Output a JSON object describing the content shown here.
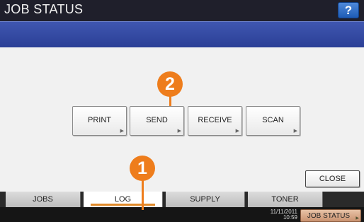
{
  "window": {
    "title": "JOB STATUS",
    "help_label": "?"
  },
  "log_buttons": [
    {
      "label": "PRINT"
    },
    {
      "label": "SEND"
    },
    {
      "label": "RECEIVE"
    },
    {
      "label": "SCAN"
    }
  ],
  "close_label": "CLOSE",
  "tabs": [
    {
      "label": "JOBS",
      "active": false
    },
    {
      "label": "LOG",
      "active": true
    },
    {
      "label": "SUPPLY",
      "active": false
    },
    {
      "label": "TONER",
      "active": false
    }
  ],
  "status_bar": {
    "date": "11/11/2011",
    "time": "10:59",
    "job_status_label": "JOB STATUS"
  },
  "callouts": [
    {
      "number": "1"
    },
    {
      "number": "2"
    }
  ],
  "colors": {
    "title_bar": "#1f1f2b",
    "message_band": "#2b3f96",
    "callout": "#ee7d1c",
    "active_tab_underline": "#e08a2a"
  },
  "icons": [
    "help-icon",
    "arrow-indicator-icon"
  ]
}
